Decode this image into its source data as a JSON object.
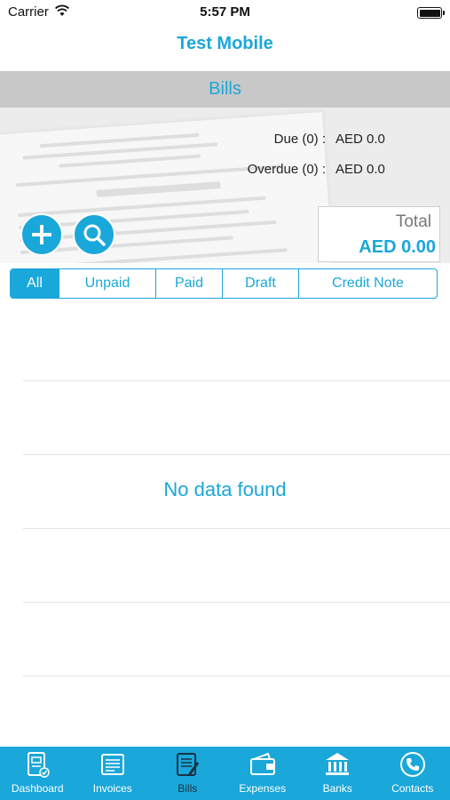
{
  "status_bar": {
    "carrier": "Carrier",
    "time": "5:57 PM"
  },
  "nav": {
    "title": "Test Mobile"
  },
  "section": {
    "title": "Bills"
  },
  "summary": {
    "due_label": "Due (0) :",
    "due_value": "AED 0.0",
    "overdue_label": "Overdue (0) :",
    "overdue_value": "AED 0.0",
    "total_label": "Total",
    "total_value": "AED 0.00"
  },
  "actions": {
    "add_icon": "plus-icon",
    "search_icon": "search-icon"
  },
  "filter_tabs": [
    {
      "label": "All",
      "active": true
    },
    {
      "label": "Unpaid",
      "active": false
    },
    {
      "label": "Paid",
      "active": false
    },
    {
      "label": "Draft",
      "active": false
    },
    {
      "label": "Credit Note",
      "active": false
    }
  ],
  "list": {
    "empty_message": "No data found"
  },
  "tab_bar": [
    {
      "label": "Dashboard",
      "icon": "dashboard-icon",
      "active": false
    },
    {
      "label": "Invoices",
      "icon": "invoices-icon",
      "active": false
    },
    {
      "label": "Bills",
      "icon": "bills-icon",
      "active": true
    },
    {
      "label": "Expenses",
      "icon": "wallet-icon",
      "active": false
    },
    {
      "label": "Banks",
      "icon": "bank-icon",
      "active": false
    },
    {
      "label": "Contacts",
      "icon": "phone-icon",
      "active": false
    }
  ],
  "colors": {
    "accent": "#1aa7d9",
    "section_bar": "#c8c8c8",
    "active_tab_text": "#1a3344"
  }
}
